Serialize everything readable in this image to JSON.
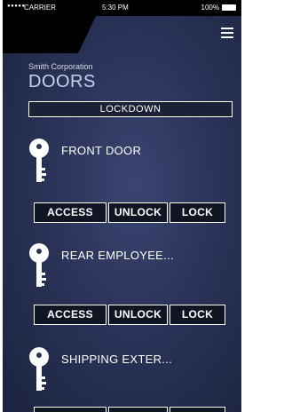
{
  "status_bar": {
    "dots": "●●●●●",
    "carrier": "CARRIER",
    "time": "5:30 PM",
    "battery": "100%"
  },
  "header": {
    "company": "Smith Corporation",
    "title": "DOORS",
    "lockdown_label": "LOCKDOWN"
  },
  "doors": [
    {
      "name": "FRONT DOOR",
      "access": "ACCESS",
      "unlock": "UNLOCK",
      "lock": "LOCK"
    },
    {
      "name": "REAR EMPLOYEE...",
      "access": "ACCESS",
      "unlock": "UNLOCK",
      "lock": "LOCK"
    },
    {
      "name": "SHIPPING EXTER...",
      "access": "",
      "unlock": "",
      "lock": ""
    }
  ],
  "colors": {
    "background": "#2a3358",
    "title": "#c5d1f0",
    "button_bg": "#101524"
  }
}
